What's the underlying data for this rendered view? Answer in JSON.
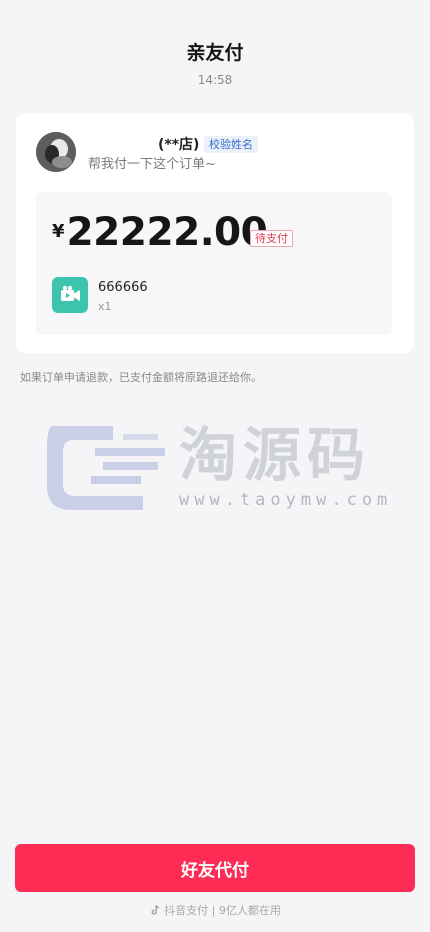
{
  "header": {
    "title": "亲友付",
    "time": "14:58"
  },
  "shop": {
    "avatar_icon": "avatar-photo",
    "name": "(**店)",
    "verify_label": "校验姓名",
    "request_text": "帮我付一下这个订单~"
  },
  "order": {
    "currency": "¥",
    "amount": "22222.00",
    "status": "待支付",
    "product_icon": "video-camera-icon",
    "product_name": "666666",
    "quantity": "x1"
  },
  "refund_note": "如果订单申请退款，已支付金额将原路退还给你。",
  "watermark": {
    "text": "淘源码",
    "url": "www.taoymw.com"
  },
  "pay_button": {
    "label": "好友代付"
  },
  "footer": {
    "icon": "douyin-icon",
    "text": "抖音支付 | 9亿人都在用"
  },
  "colors": {
    "accent": "#fe2c55",
    "status": "#e23a4c",
    "verify": "#3b6ec9",
    "product_icon_bg": "#3cc4ad",
    "background": "#f5f5f7"
  }
}
